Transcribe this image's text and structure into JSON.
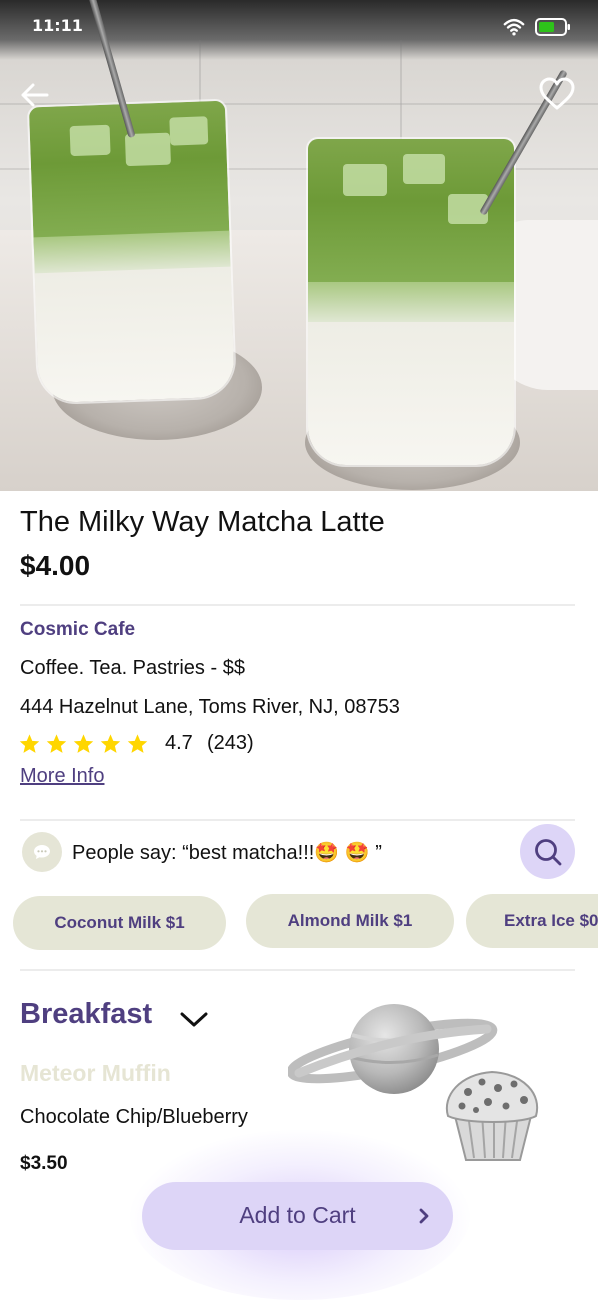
{
  "status_bar": {
    "time": "11:11"
  },
  "product": {
    "title": "The Milky Way Matcha Latte",
    "price": "$4.00"
  },
  "cafe": {
    "name": "Cosmic Cafe",
    "categories": "Coffee. Tea. Pastries - $$",
    "address": "444 Hazelnut Lane, Toms River, NJ, 08753",
    "rating": "4.7",
    "rating_value": 4.7,
    "stars_filled": 5,
    "review_count": "(243)",
    "more_info_label": "More Info"
  },
  "review": {
    "text": "People say: “best matcha!!!🤩 🤩 ”"
  },
  "addons": [
    {
      "label": "Coconut Milk $1"
    },
    {
      "label": "Almond Milk $1"
    },
    {
      "label": "Extra Ice $0"
    }
  ],
  "menu_section": {
    "title": "Breakfast",
    "item": {
      "name": "Meteor Muffin",
      "description": "Chocolate Chip/Blueberry",
      "price": "$3.50"
    }
  },
  "cart": {
    "label": "Add to Cart"
  },
  "icons": {
    "back": "arrow-left-icon",
    "favorite": "heart-icon",
    "wifi": "wifi-icon",
    "battery": "battery-icon",
    "star": "star-icon",
    "review": "chat-bubble-icon",
    "search": "search-icon",
    "chevron": "chevron-down-icon",
    "cart_arrow": "chevron-right-icon"
  },
  "colors": {
    "brand_purple": "#4f3f80",
    "accent_lavender": "#ddd5f7",
    "chip_bg": "#e5e6d6",
    "star_yellow": "#ffd600",
    "battery_green": "#2ec21a"
  }
}
